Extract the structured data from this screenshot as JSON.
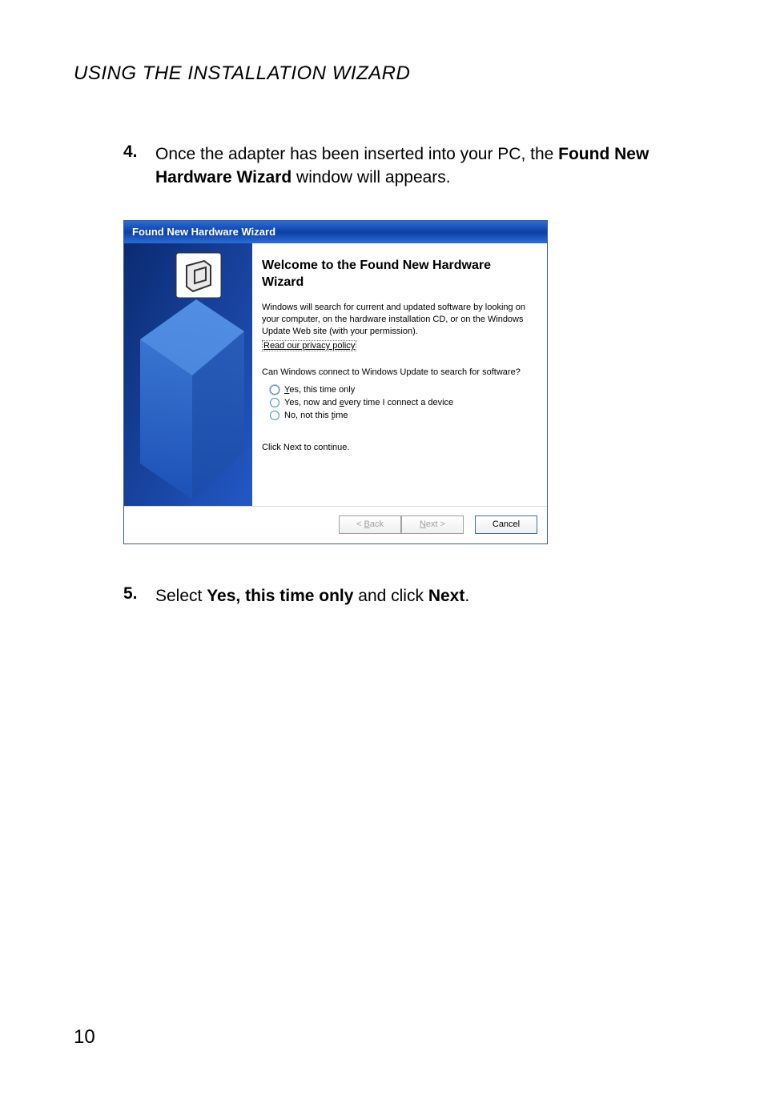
{
  "section_title_1": "U",
  "section_title_2": "SING THE ",
  "section_title_3": "I",
  "section_title_4": "NSTALLATION ",
  "section_title_5": "W",
  "section_title_6": "IZARD",
  "step4": {
    "num": "4.",
    "t1": "Once the adapter has been inserted into your PC, the ",
    "t2": "Found New Hardware Wizard",
    "t3": " window will appears."
  },
  "step5": {
    "num": "5.",
    "t1": "Select ",
    "t2": "Yes, this time only",
    "t3": " and click ",
    "t4": "Next",
    "t5": "."
  },
  "wizard": {
    "titlebar": "Found New Hardware Wizard",
    "heading": "Welcome to the Found New Hardware Wizard",
    "para": "Windows will search for current and updated software by looking on your computer, on the hardware installation CD, or on the Windows Update Web site (with your permission).",
    "link": "Read our privacy policy",
    "question": "Can Windows connect to Windows Update to search for software?",
    "opts": {
      "a_pre": "Y",
      "a_rest": "es, this time only",
      "b_pre": "Yes, now and ",
      "b_u": "e",
      "b_rest": "very time I connect a device",
      "c_pre": "No, not this ",
      "c_u": "t",
      "c_rest": "ime"
    },
    "continue": "Click Next to continue.",
    "buttons": {
      "back_lt": "< ",
      "back_u": "B",
      "back_rest": "ack",
      "next_u": "N",
      "next_rest": "ext >",
      "cancel": "Cancel"
    }
  },
  "page_number": "10"
}
